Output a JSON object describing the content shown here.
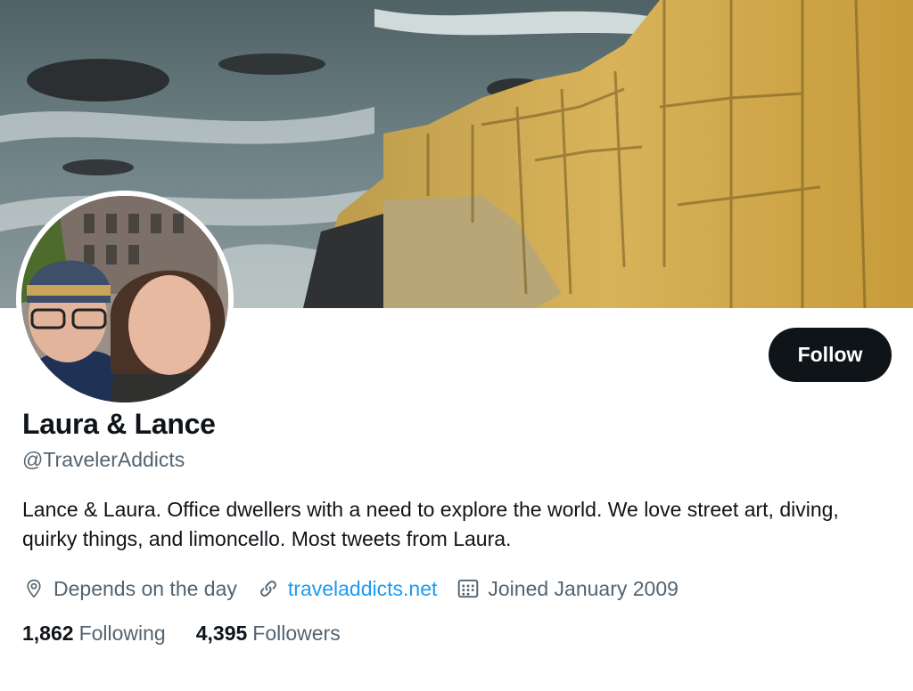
{
  "profile": {
    "display_name": "Laura & Lance",
    "handle": "@TravelerAddicts",
    "bio": "Lance & Laura. Office dwellers with a need to explore the world. We love street art, diving, quirky things, and limoncello. Most tweets from Laura.",
    "follow_label": "Follow"
  },
  "meta": {
    "location": "Depends on the day",
    "website": "traveladdicts.net",
    "joined": "Joined January 2009",
    "icons": [
      "location-icon",
      "link-icon",
      "calendar-icon"
    ]
  },
  "stats": {
    "following_count": "1,862",
    "following_label": "Following",
    "followers_count": "4,395",
    "followers_label": "Followers"
  },
  "colors": {
    "text": "#0f1419",
    "secondary": "#536471",
    "link": "#1d9bf0",
    "button_bg": "#0f1419",
    "button_text": "#ffffff"
  }
}
